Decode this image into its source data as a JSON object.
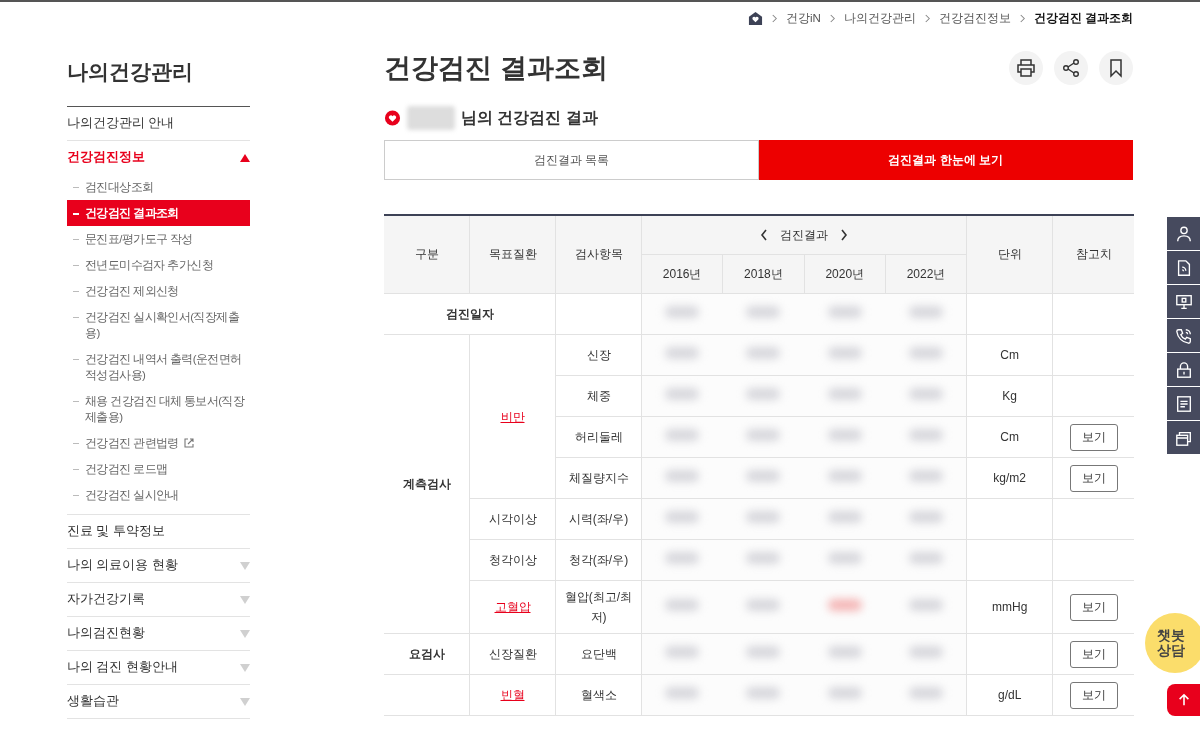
{
  "breadcrumb": {
    "items": [
      {
        "label": "건강iN",
        "current": false
      },
      {
        "label": "나의건강관리",
        "current": false
      },
      {
        "label": "건강검진정보",
        "current": false
      },
      {
        "label": "건강검진 결과조회",
        "current": true
      }
    ]
  },
  "sidebar": {
    "title": "나의건강관리",
    "items": [
      {
        "label": "나의건강관리 안내",
        "kind": "link",
        "selected": false
      },
      {
        "label": "건강검진정보",
        "kind": "menu",
        "selected": true,
        "expanded": true,
        "children": [
          {
            "label": "검진대상조회",
            "selected": false,
            "external": false
          },
          {
            "label": "건강검진 결과조회",
            "selected": true,
            "external": false
          },
          {
            "label": "문진표/평가도구 작성",
            "selected": false,
            "external": false
          },
          {
            "label": "전년도미수검자 추가신청",
            "selected": false,
            "external": false
          },
          {
            "label": "건강검진 제외신청",
            "selected": false,
            "external": false
          },
          {
            "label": "건강검진 실시확인서(직장제출용)",
            "selected": false,
            "external": false
          },
          {
            "label": "건강검진 내역서 출력(운전면허적성검사용)",
            "selected": false,
            "external": false
          },
          {
            "label": "채용 건강검진 대체 통보서(직장제출용)",
            "selected": false,
            "external": false
          },
          {
            "label": "건강검진 관련법령",
            "selected": false,
            "external": true
          },
          {
            "label": "건강검진 로드맵",
            "selected": false,
            "external": false
          },
          {
            "label": "건강검진 실시안내",
            "selected": false,
            "external": false
          }
        ]
      },
      {
        "label": "진료 및 투약정보",
        "kind": "link",
        "selected": false
      },
      {
        "label": "나의 의료이용 현황",
        "kind": "menu",
        "selected": false,
        "expanded": false
      },
      {
        "label": "자가건강기록",
        "kind": "menu",
        "selected": false,
        "expanded": false
      },
      {
        "label": "나의검진현황",
        "kind": "menu",
        "selected": false,
        "expanded": false
      },
      {
        "label": "나의 검진 현황안내",
        "kind": "menu",
        "selected": false,
        "expanded": false
      },
      {
        "label": "생활습관",
        "kind": "menu",
        "selected": false,
        "expanded": false
      }
    ]
  },
  "page": {
    "title": "건강검진 결과조회",
    "subtitle": "님의 건강검진 결과"
  },
  "tabs": [
    {
      "label": "검진결과 목록",
      "selected": false
    },
    {
      "label": "검진결과 한눈에 보기",
      "selected": true
    }
  ],
  "table": {
    "columns": {
      "category": "구분",
      "target": "목표질환",
      "item": "검사항목",
      "results": "검진결과",
      "years": [
        "2016년",
        "2018년",
        "2020년",
        "2022년"
      ],
      "unit": "단위",
      "reference": "참고치"
    },
    "date_row": {
      "label": "검진일자",
      "results": [
        {
          "abnormal": false
        },
        {
          "abnormal": false
        },
        {
          "abnormal": false
        },
        {
          "abnormal": false
        }
      ]
    },
    "groups": [
      {
        "label": "계측검사",
        "targets": [
          {
            "label": "비만",
            "linked": true,
            "items": [
              {
                "name": "신장",
                "unit": "Cm",
                "results": [
                  {
                    "abnormal": false
                  },
                  {
                    "abnormal": false
                  },
                  {
                    "abnormal": false
                  },
                  {
                    "abnormal": false
                  }
                ]
              },
              {
                "name": "체중",
                "unit": "Kg",
                "results": [
                  {
                    "abnormal": false
                  },
                  {
                    "abnormal": false
                  },
                  {
                    "abnormal": false
                  },
                  {
                    "abnormal": false
                  }
                ]
              },
              {
                "name": "허리둘레",
                "unit": "Cm",
                "button": "보기",
                "results": [
                  {
                    "abnormal": false
                  },
                  {
                    "abnormal": false
                  },
                  {
                    "abnormal": false
                  },
                  {
                    "abnormal": false
                  }
                ]
              },
              {
                "name": "체질량지수",
                "unit": "kg/m2",
                "button": "보기",
                "results": [
                  {
                    "abnormal": false
                  },
                  {
                    "abnormal": false
                  },
                  {
                    "abnormal": false
                  },
                  {
                    "abnormal": false
                  }
                ]
              }
            ]
          },
          {
            "label": "시각이상",
            "linked": false,
            "items": [
              {
                "name": "시력(좌/우)",
                "results": [
                  {
                    "abnormal": false
                  },
                  {
                    "abnormal": false
                  },
                  {
                    "abnormal": false
                  },
                  {
                    "abnormal": false
                  }
                ]
              }
            ]
          },
          {
            "label": "청각이상",
            "linked": false,
            "items": [
              {
                "name": "청각(좌/우)",
                "results": [
                  {
                    "abnormal": false
                  },
                  {
                    "abnormal": false
                  },
                  {
                    "abnormal": false
                  },
                  {
                    "abnormal": false
                  }
                ]
              }
            ]
          },
          {
            "label": "고혈압",
            "linked": true,
            "items": [
              {
                "name": "혈압(최고/최저)",
                "unit": "mmHg",
                "button": "보기",
                "results": [
                  {
                    "abnormal": false
                  },
                  {
                    "abnormal": false
                  },
                  {
                    "abnormal": true
                  },
                  {
                    "abnormal": false
                  }
                ]
              }
            ]
          }
        ]
      },
      {
        "label": "요검사",
        "targets": [
          {
            "label": "신장질환",
            "linked": false,
            "items": [
              {
                "name": "요단백",
                "button": "보기",
                "results": [
                  {
                    "abnormal": false
                  },
                  {
                    "abnormal": false
                  },
                  {
                    "abnormal": false
                  },
                  {
                    "abnormal": false
                  }
                ]
              }
            ]
          }
        ]
      },
      {
        "targets": [
          {
            "label": "빈혈",
            "linked": true,
            "items": [
              {
                "name": "혈색소",
                "unit": "g/dL",
                "button": "보기",
                "results": [
                  {
                    "abnormal": false
                  },
                  {
                    "abnormal": false
                  },
                  {
                    "abnormal": false
                  },
                  {
                    "abnormal": false
                  }
                ]
              }
            ]
          }
        ]
      }
    ]
  },
  "quick_menu": {
    "items": [
      {
        "kind": "person"
      },
      {
        "kind": "document"
      },
      {
        "kind": "monitor"
      },
      {
        "kind": "phone"
      },
      {
        "kind": "lock"
      },
      {
        "kind": "list"
      },
      {
        "kind": "windows"
      }
    ]
  },
  "chatbot": {
    "label": "챗봇 상담"
  }
}
